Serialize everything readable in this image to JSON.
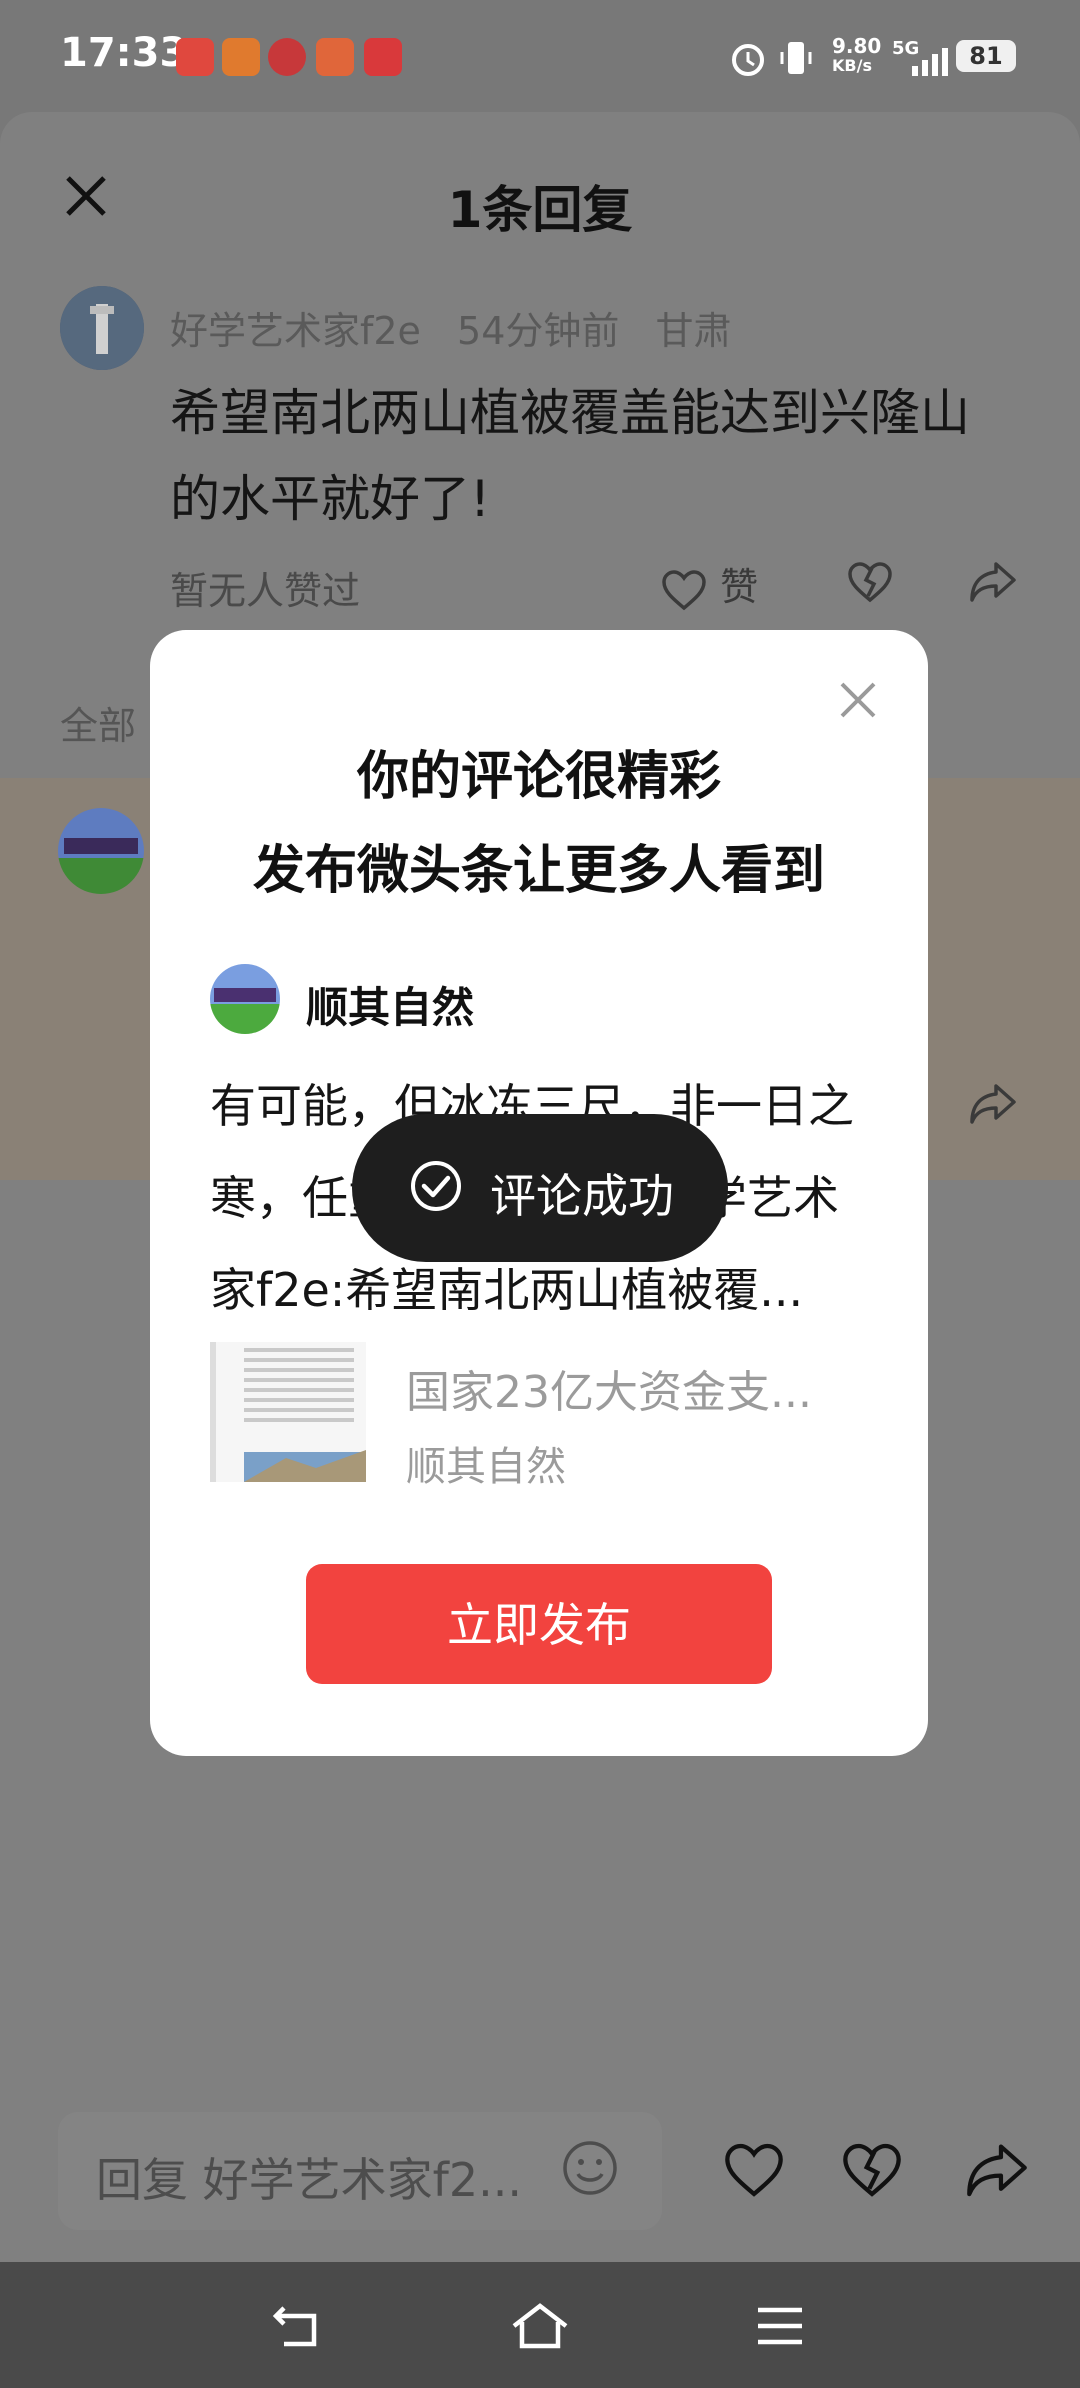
{
  "status_bar": {
    "time": "17:33",
    "network_speed": "9.80",
    "network_unit": "KB/s",
    "signal": "5G",
    "battery": "81",
    "notification_icons": [
      "toutiao-icon",
      "kuaishou-icon",
      "netease-icon",
      "mail-icon",
      "chart-icon"
    ]
  },
  "sheet": {
    "title": "1条回复",
    "comment": {
      "username": "好学艺术家f2e",
      "time_ago": "54分钟前",
      "location": "甘肃",
      "text": "希望南北两山植被覆盖能达到兴隆山的水平就好了!",
      "likes_text": "暂无人赞过",
      "like_label": "赞"
    },
    "all_label": "全部"
  },
  "modal": {
    "title_line1": "你的评论很精彩",
    "title_line2": "发布微头条让更多人看到",
    "author": "顺其自然",
    "quote": "有可能，但冰冻三尺，非一日之寒，任重而道远。//@好学艺术家f2e:希望南北两山植被覆...",
    "article_title": "国家23亿大资金支...",
    "article_source": "顺其自然",
    "publish_label": "立即发布"
  },
  "toast": {
    "label": "评论成功"
  },
  "reply_bar": {
    "placeholder": "回复 好学艺术家f2..."
  },
  "colors": {
    "accent": "#f2433f",
    "overlay": "#808080",
    "toast_bg": "#1e1e1e"
  }
}
